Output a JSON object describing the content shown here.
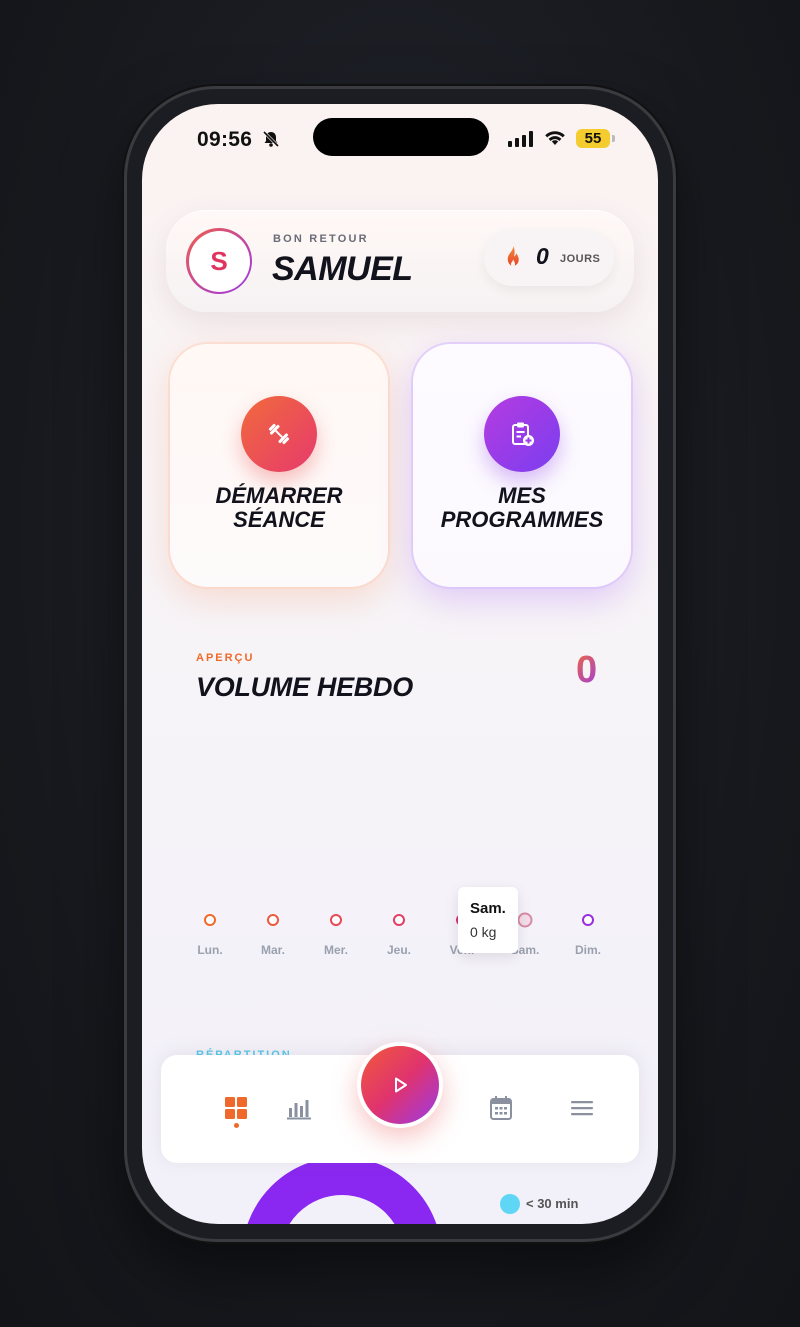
{
  "status_bar": {
    "time": "09:56",
    "battery": "55"
  },
  "header": {
    "welcome": "BON RETOUR",
    "avatar_initial": "S",
    "user_name": "SAMUEL",
    "streak_count": "0",
    "streak_unit": "JOURS"
  },
  "actions": {
    "start_label": "DÉMARRER SÉANCE",
    "programs_label": "MES PROGRAMMES"
  },
  "overview": {
    "label": "APERÇU",
    "title": "VOLUME HEBDO",
    "total": "0",
    "tooltip": {
      "day": "Sam.",
      "value": "0 kg"
    }
  },
  "chart_data": {
    "type": "line",
    "categories": [
      "Lun.",
      "Mar.",
      "Mer.",
      "Jeu.",
      "Ven.",
      "Sam.",
      "Dim."
    ],
    "series": [
      {
        "values": [
          0,
          0,
          0,
          0,
          0,
          0,
          0
        ]
      }
    ],
    "unit": "kg"
  },
  "repartition": {
    "label": "RÉPARTITION",
    "legend": "< 30 min"
  },
  "nav": {
    "items": [
      {
        "icon": "dashboard-icon",
        "active": true
      },
      {
        "icon": "stats-icon"
      },
      {
        "icon": "play-icon"
      },
      {
        "icon": "calendar-icon"
      },
      {
        "icon": "menu-icon"
      }
    ]
  },
  "colors": {
    "accent_orange": "#ef6a2a",
    "accent_pink": "#e0336e",
    "accent_purple": "#8a27f0",
    "legend_cyan": "#5fd6f5"
  }
}
